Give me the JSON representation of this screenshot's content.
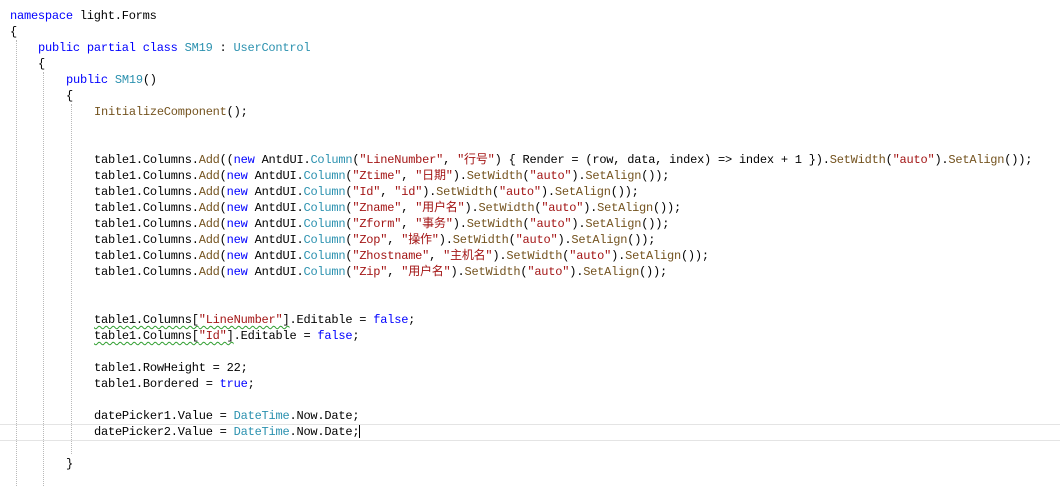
{
  "editor": {
    "lines": [
      {
        "tokens": [
          {
            "t": "namespace",
            "c": "kw"
          },
          {
            "t": " light.Forms"
          }
        ]
      },
      {
        "tokens": [
          {
            "t": "{"
          }
        ]
      },
      {
        "tokens": [
          {
            "t": "public",
            "c": "kw"
          },
          {
            "t": " "
          },
          {
            "t": "partial",
            "c": "kw"
          },
          {
            "t": " "
          },
          {
            "t": "class",
            "c": "kw"
          },
          {
            "t": " "
          },
          {
            "t": "SM19",
            "c": "ty"
          },
          {
            "t": " : "
          },
          {
            "t": "UserControl",
            "c": "ty"
          }
        ]
      },
      {
        "tokens": [
          {
            "t": "{"
          }
        ]
      },
      {
        "tokens": [
          {
            "t": "public",
            "c": "kw"
          },
          {
            "t": " "
          },
          {
            "t": "SM19",
            "c": "ty"
          },
          {
            "t": "()"
          }
        ]
      },
      {
        "tokens": [
          {
            "t": "{"
          }
        ]
      },
      {
        "tokens": [
          {
            "t": "InitializeComponent",
            "c": "fn"
          },
          {
            "t": "();"
          }
        ]
      },
      {
        "tokens": []
      },
      {
        "tokens": []
      },
      {
        "tokens": [
          {
            "t": "table1.Columns."
          },
          {
            "t": "Add",
            "c": "fn"
          },
          {
            "t": "(("
          },
          {
            "t": "new",
            "c": "kw"
          },
          {
            "t": " AntdUI."
          },
          {
            "t": "Column",
            "c": "ty"
          },
          {
            "t": "("
          },
          {
            "t": "\"LineNumber\"",
            "c": "str"
          },
          {
            "t": ", "
          },
          {
            "t": "\"行号\"",
            "c": "str"
          },
          {
            "t": ") { Render = (row, data, index) => index + 1 })."
          },
          {
            "t": "SetWidth",
            "c": "fn"
          },
          {
            "t": "("
          },
          {
            "t": "\"auto\"",
            "c": "str"
          },
          {
            "t": ")."
          },
          {
            "t": "SetAlign",
            "c": "fn"
          },
          {
            "t": "());"
          }
        ]
      },
      {
        "tokens": [
          {
            "t": "table1.Columns."
          },
          {
            "t": "Add",
            "c": "fn"
          },
          {
            "t": "("
          },
          {
            "t": "new",
            "c": "kw"
          },
          {
            "t": " AntdUI."
          },
          {
            "t": "Column",
            "c": "ty"
          },
          {
            "t": "("
          },
          {
            "t": "\"Ztime\"",
            "c": "str"
          },
          {
            "t": ", "
          },
          {
            "t": "\"日期\"",
            "c": "str"
          },
          {
            "t": ")."
          },
          {
            "t": "SetWidth",
            "c": "fn"
          },
          {
            "t": "("
          },
          {
            "t": "\"auto\"",
            "c": "str"
          },
          {
            "t": ")."
          },
          {
            "t": "SetAlign",
            "c": "fn"
          },
          {
            "t": "());"
          }
        ]
      },
      {
        "tokens": [
          {
            "t": "table1.Columns."
          },
          {
            "t": "Add",
            "c": "fn"
          },
          {
            "t": "("
          },
          {
            "t": "new",
            "c": "kw"
          },
          {
            "t": " AntdUI."
          },
          {
            "t": "Column",
            "c": "ty"
          },
          {
            "t": "("
          },
          {
            "t": "\"Id\"",
            "c": "str"
          },
          {
            "t": ", "
          },
          {
            "t": "\"id\"",
            "c": "str"
          },
          {
            "t": ")."
          },
          {
            "t": "SetWidth",
            "c": "fn"
          },
          {
            "t": "("
          },
          {
            "t": "\"auto\"",
            "c": "str"
          },
          {
            "t": ")."
          },
          {
            "t": "SetAlign",
            "c": "fn"
          },
          {
            "t": "());"
          }
        ]
      },
      {
        "tokens": [
          {
            "t": "table1.Columns."
          },
          {
            "t": "Add",
            "c": "fn"
          },
          {
            "t": "("
          },
          {
            "t": "new",
            "c": "kw"
          },
          {
            "t": " AntdUI."
          },
          {
            "t": "Column",
            "c": "ty"
          },
          {
            "t": "("
          },
          {
            "t": "\"Zname\"",
            "c": "str"
          },
          {
            "t": ", "
          },
          {
            "t": "\"用户名\"",
            "c": "str"
          },
          {
            "t": ")."
          },
          {
            "t": "SetWidth",
            "c": "fn"
          },
          {
            "t": "("
          },
          {
            "t": "\"auto\"",
            "c": "str"
          },
          {
            "t": ")."
          },
          {
            "t": "SetAlign",
            "c": "fn"
          },
          {
            "t": "());"
          }
        ]
      },
      {
        "tokens": [
          {
            "t": "table1.Columns."
          },
          {
            "t": "Add",
            "c": "fn"
          },
          {
            "t": "("
          },
          {
            "t": "new",
            "c": "kw"
          },
          {
            "t": " AntdUI."
          },
          {
            "t": "Column",
            "c": "ty"
          },
          {
            "t": "("
          },
          {
            "t": "\"Zform\"",
            "c": "str"
          },
          {
            "t": ", "
          },
          {
            "t": "\"事务\"",
            "c": "str"
          },
          {
            "t": ")."
          },
          {
            "t": "SetWidth",
            "c": "fn"
          },
          {
            "t": "("
          },
          {
            "t": "\"auto\"",
            "c": "str"
          },
          {
            "t": ")."
          },
          {
            "t": "SetAlign",
            "c": "fn"
          },
          {
            "t": "());"
          }
        ]
      },
      {
        "tokens": [
          {
            "t": "table1.Columns."
          },
          {
            "t": "Add",
            "c": "fn"
          },
          {
            "t": "("
          },
          {
            "t": "new",
            "c": "kw"
          },
          {
            "t": " AntdUI."
          },
          {
            "t": "Column",
            "c": "ty"
          },
          {
            "t": "("
          },
          {
            "t": "\"Zop\"",
            "c": "str"
          },
          {
            "t": ", "
          },
          {
            "t": "\"操作\"",
            "c": "str"
          },
          {
            "t": ")."
          },
          {
            "t": "SetWidth",
            "c": "fn"
          },
          {
            "t": "("
          },
          {
            "t": "\"auto\"",
            "c": "str"
          },
          {
            "t": ")."
          },
          {
            "t": "SetAlign",
            "c": "fn"
          },
          {
            "t": "());"
          }
        ]
      },
      {
        "tokens": [
          {
            "t": "table1.Columns."
          },
          {
            "t": "Add",
            "c": "fn"
          },
          {
            "t": "("
          },
          {
            "t": "new",
            "c": "kw"
          },
          {
            "t": " AntdUI."
          },
          {
            "t": "Column",
            "c": "ty"
          },
          {
            "t": "("
          },
          {
            "t": "\"Zhostname\"",
            "c": "str"
          },
          {
            "t": ", "
          },
          {
            "t": "\"主机名\"",
            "c": "str"
          },
          {
            "t": ")."
          },
          {
            "t": "SetWidth",
            "c": "fn"
          },
          {
            "t": "("
          },
          {
            "t": "\"auto\"",
            "c": "str"
          },
          {
            "t": ")."
          },
          {
            "t": "SetAlign",
            "c": "fn"
          },
          {
            "t": "());"
          }
        ]
      },
      {
        "tokens": [
          {
            "t": "table1.Columns."
          },
          {
            "t": "Add",
            "c": "fn"
          },
          {
            "t": "("
          },
          {
            "t": "new",
            "c": "kw"
          },
          {
            "t": " AntdUI."
          },
          {
            "t": "Column",
            "c": "ty"
          },
          {
            "t": "("
          },
          {
            "t": "\"Zip\"",
            "c": "str"
          },
          {
            "t": ", "
          },
          {
            "t": "\"用户名\"",
            "c": "str"
          },
          {
            "t": ")."
          },
          {
            "t": "SetWidth",
            "c": "fn"
          },
          {
            "t": "("
          },
          {
            "t": "\"auto\"",
            "c": "str"
          },
          {
            "t": ")."
          },
          {
            "t": "SetAlign",
            "c": "fn"
          },
          {
            "t": "());"
          }
        ]
      },
      {
        "tokens": []
      },
      {
        "tokens": []
      },
      {
        "tokens": [
          {
            "t": "table1.Columns[",
            "u": true
          },
          {
            "t": "\"LineNumber\"",
            "c": "str",
            "u": true
          },
          {
            "t": "]",
            "u": true
          },
          {
            "t": ".Editable = "
          },
          {
            "t": "false",
            "c": "kw"
          },
          {
            "t": ";"
          }
        ]
      },
      {
        "tokens": [
          {
            "t": "table1.Columns[",
            "u": true
          },
          {
            "t": "\"Id\"",
            "c": "str",
            "u": true
          },
          {
            "t": "]",
            "u": true
          },
          {
            "t": ".Editable = "
          },
          {
            "t": "false",
            "c": "kw"
          },
          {
            "t": ";"
          }
        ]
      },
      {
        "tokens": []
      },
      {
        "tokens": [
          {
            "t": "table1.RowHeight = 22;"
          }
        ]
      },
      {
        "tokens": [
          {
            "t": "table1.Bordered = "
          },
          {
            "t": "true",
            "c": "kw"
          },
          {
            "t": ";"
          }
        ]
      },
      {
        "tokens": []
      },
      {
        "tokens": [
          {
            "t": "datePicker1.Value = "
          },
          {
            "t": "DateTime",
            "c": "ty"
          },
          {
            "t": ".Now.Date;"
          }
        ]
      },
      {
        "tokens": [
          {
            "t": "datePicker2.Value = "
          },
          {
            "t": "DateTime",
            "c": "ty"
          },
          {
            "t": ".Now.Date;"
          }
        ],
        "current": true
      },
      {
        "tokens": []
      },
      {
        "tokens": [
          {
            "t": "}"
          }
        ]
      }
    ]
  }
}
